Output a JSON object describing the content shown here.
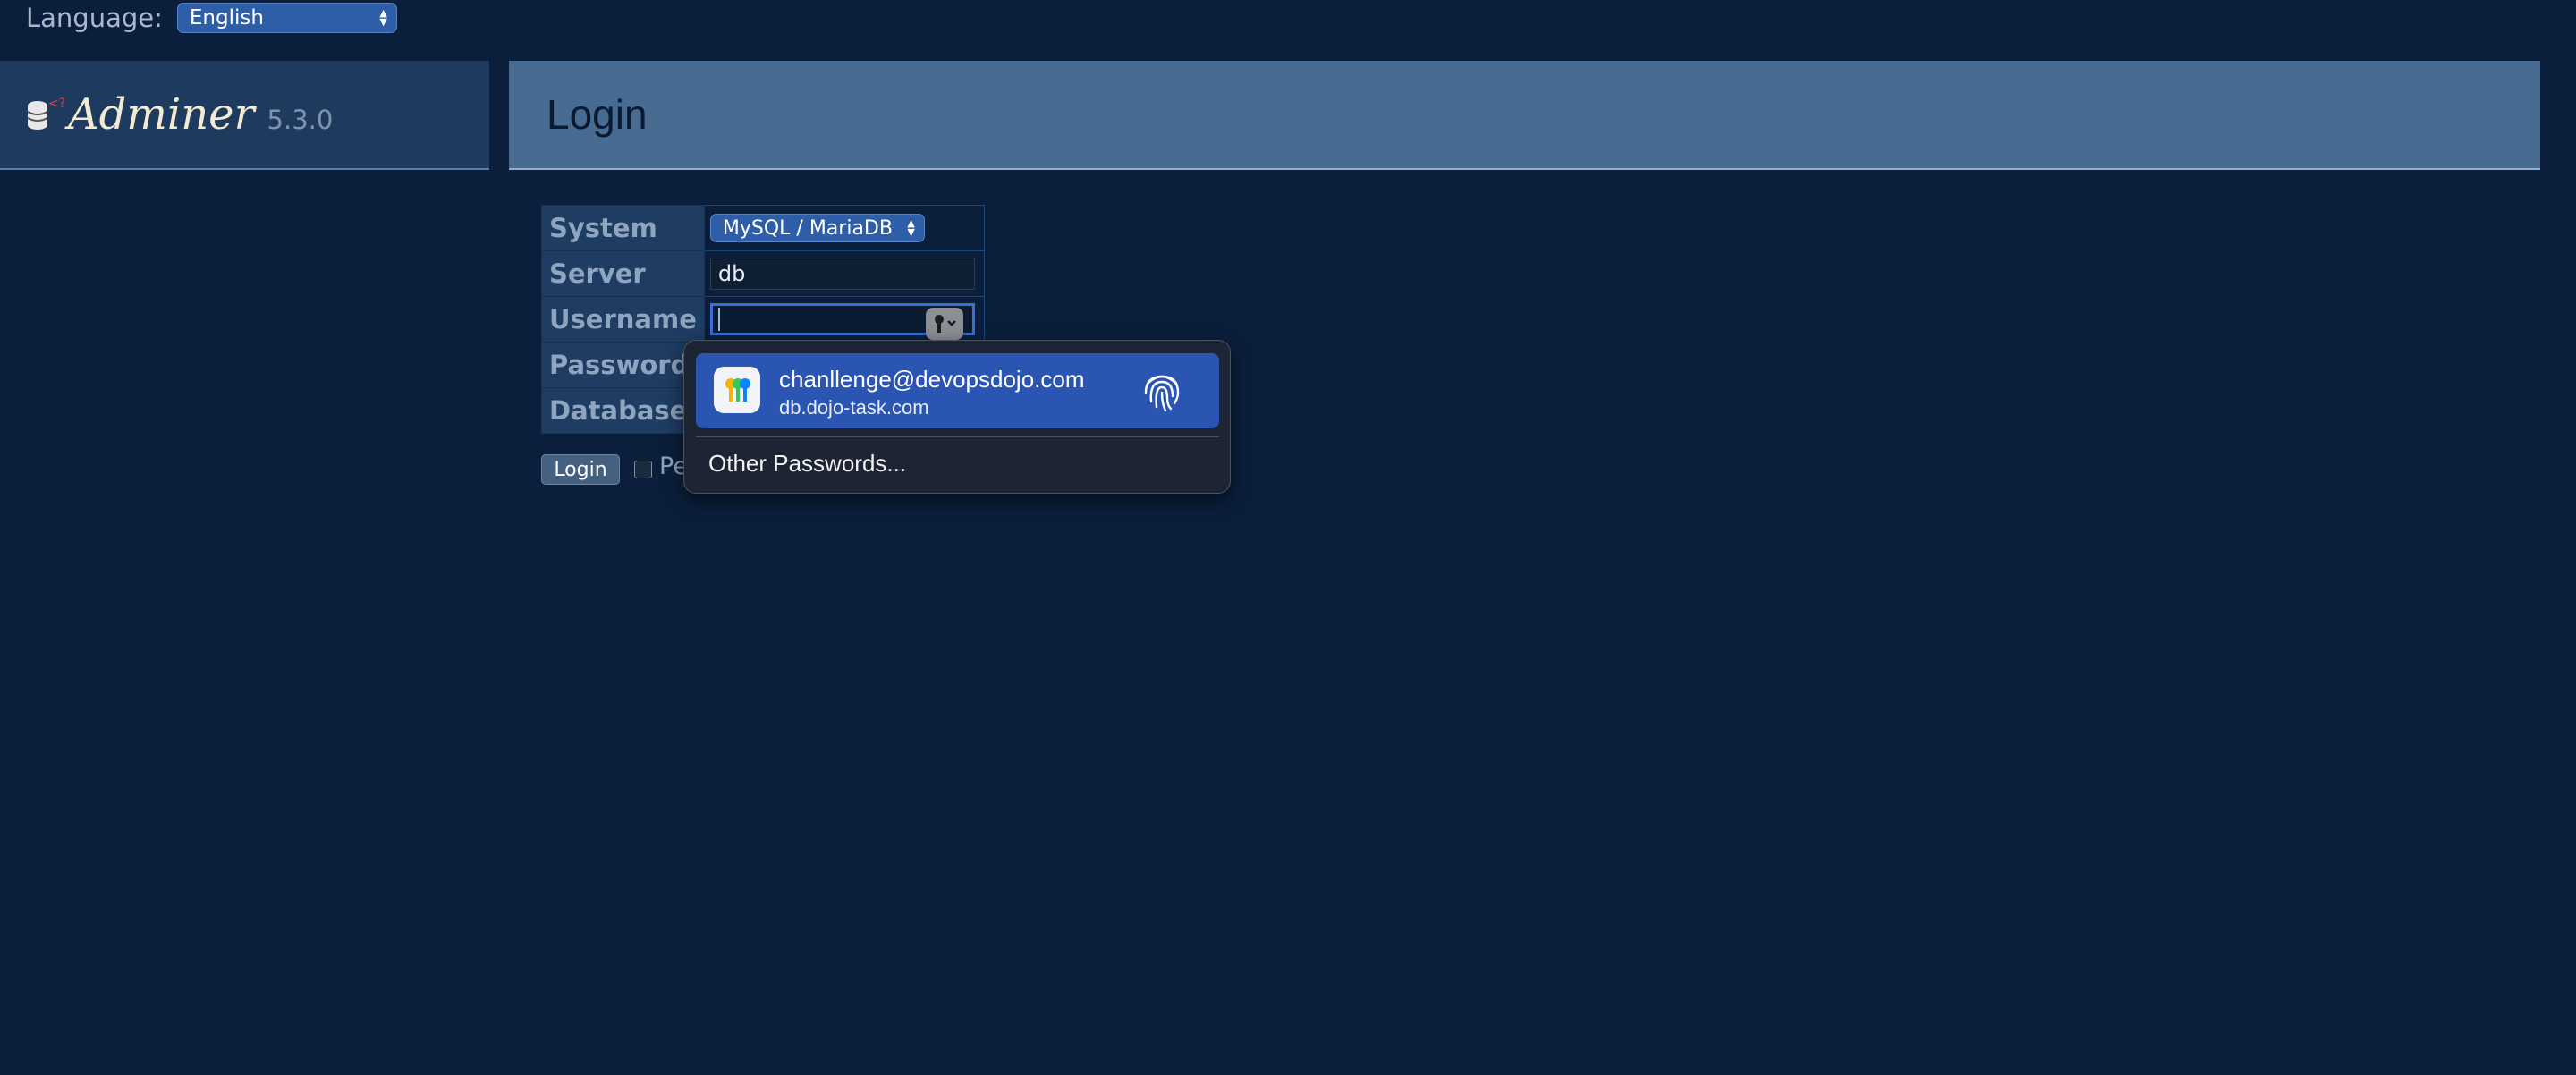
{
  "language": {
    "label": "Language:",
    "selected": "English"
  },
  "brand": {
    "name": "Adminer",
    "version": "5.3.0"
  },
  "header": {
    "title": "Login"
  },
  "form": {
    "system_label": "System",
    "system_value": "MySQL / MariaDB",
    "server_label": "Server",
    "server_value": "db",
    "username_label": "Username",
    "username_value": "",
    "password_label": "Password",
    "database_label": "Database"
  },
  "actions": {
    "login_label": "Login",
    "permanent_label_visible": "Pe"
  },
  "autofill": {
    "username": "chanllenge@devopsdojo.com",
    "host": "db.dojo-task.com",
    "other": "Other Passwords..."
  },
  "icons": {
    "brand": "database-icon",
    "key": "key-icon",
    "passwords": "passwords-app-icon",
    "fingerprint": "fingerprint-icon"
  },
  "colors": {
    "background": "#0b1f3d",
    "header": "#486b91",
    "accent": "#2a55b3"
  }
}
